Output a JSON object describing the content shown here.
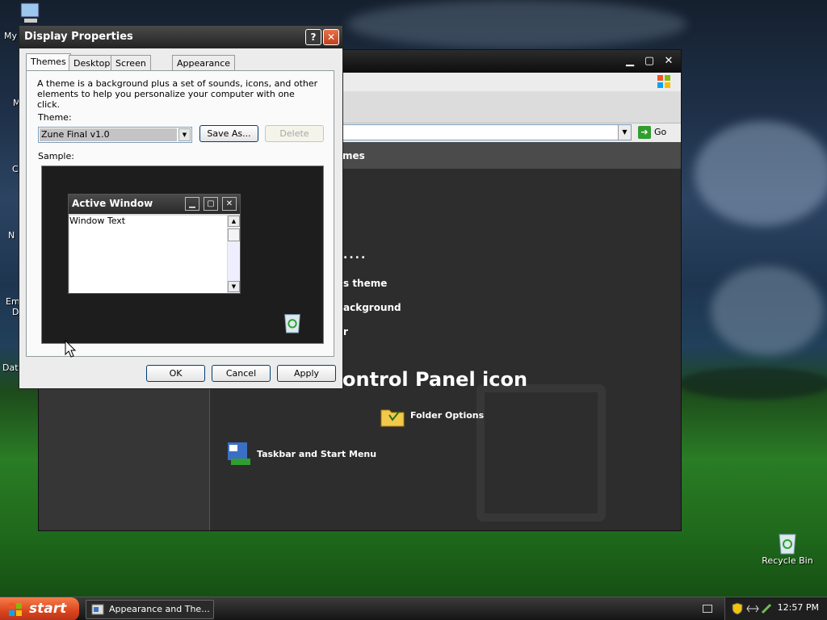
{
  "desktop": {
    "icons": [
      {
        "label": "My"
      },
      {
        "label": "M"
      },
      {
        "label": "C"
      },
      {
        "label": "N"
      },
      {
        "label": "Em"
      },
      {
        "label": "D"
      },
      {
        "label": "Dat"
      }
    ],
    "recycle_bin": "Recycle Bin"
  },
  "control_panel": {
    "go_label": "Go",
    "header": "mes",
    "items": [
      {
        "text": "...."
      },
      {
        "text": "s theme"
      },
      {
        "text": "ackground"
      },
      {
        "text": "r"
      }
    ],
    "big_heading": "ontrol Panel icon",
    "folder_options": "Folder Options",
    "taskbar_start": "Taskbar and Start Menu"
  },
  "dialog": {
    "title": "Display Properties",
    "help_glyph": "?",
    "close_glyph": "✕",
    "tabs": [
      "Themes",
      "Desktop",
      "Screen Saver",
      "Appearance"
    ],
    "description": "A theme is a background plus a set of sounds, icons, and other elements to help you personalize your computer with one click.",
    "theme_label": "Theme:",
    "theme_value": "Zune Final v1.0",
    "save_as": "Save As...",
    "delete": "Delete",
    "sample_label": "Sample:",
    "preview": {
      "title": "Active Window",
      "text": "Window Text"
    },
    "ok": "OK",
    "cancel": "Cancel",
    "apply": "Apply"
  },
  "taskbar": {
    "start": "start",
    "task": "Appearance and The...",
    "clock": "12:57 PM"
  }
}
